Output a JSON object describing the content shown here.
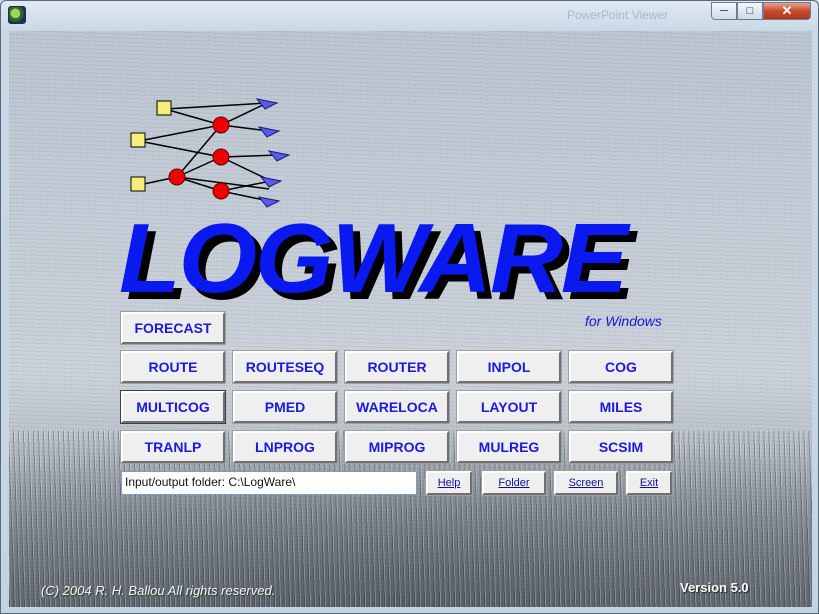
{
  "window": {
    "ghost_title": "PowerPoint Viewer"
  },
  "logo": {
    "title": "LOGWARE",
    "tagline": "for Windows"
  },
  "modules": {
    "forecast": "FORECAST",
    "row1": [
      "ROUTE",
      "ROUTESEQ",
      "ROUTER",
      "INPOL",
      "COG"
    ],
    "row2": [
      "MULTICOG",
      "PMED",
      "WARELOCA",
      "LAYOUT",
      "MILES"
    ],
    "row3": [
      "TRANLP",
      "LNPROG",
      "MIPROG",
      "MULREG",
      "SCSIM"
    ]
  },
  "folder": {
    "value": "Input/output folder: C:\\LogWare\\"
  },
  "actions": {
    "help": "Help",
    "folder": "Folder",
    "screen": "Screen",
    "exit": "Exit"
  },
  "footer": {
    "copyright": "(C) 2004 R. H. Ballou  All rights reserved.",
    "version": "Version 5.0"
  },
  "colors": {
    "logo_blue": "#0a19f0",
    "button_text": "#1a1ae0",
    "node_yellow": "#f4f07a",
    "node_red": "#ee0000",
    "node_blue": "#5a5ae6"
  },
  "icons": {
    "app": "logware-app-icon",
    "minimize": "minimize-icon",
    "maximize": "maximize-icon",
    "close": "close-icon"
  }
}
